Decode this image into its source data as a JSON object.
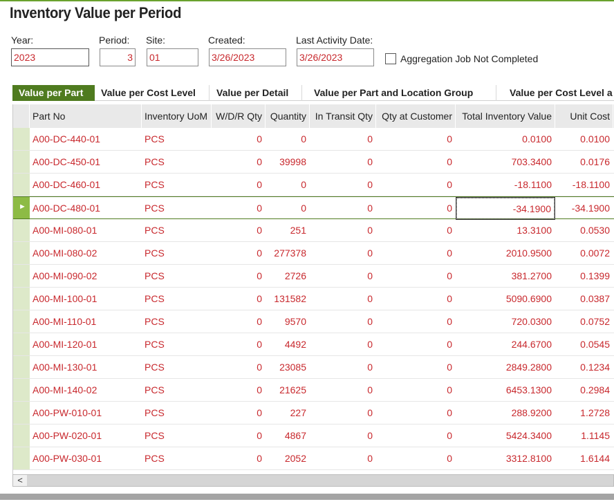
{
  "title": "Inventory Value per Period",
  "fields": {
    "year": {
      "label": "Year:",
      "value": "2023"
    },
    "period": {
      "label": "Period:",
      "value": "3"
    },
    "site": {
      "label": "Site:",
      "value": "01"
    },
    "created": {
      "label": "Created:",
      "value": "3/26/2023"
    },
    "last_activity": {
      "label": "Last Activity Date:",
      "value": "3/26/2023"
    },
    "aggregation": {
      "label": "Aggregation Job Not Completed",
      "checked": false
    }
  },
  "tabs": [
    {
      "label": "Value per Part",
      "active": true
    },
    {
      "label": "Value per Cost Level",
      "active": false
    },
    {
      "label": "Value per Detail",
      "active": false
    },
    {
      "label": "Value per Part and Location Group",
      "active": false
    },
    {
      "label": "Value per Cost Level a",
      "active": false
    }
  ],
  "columns": [
    "Part No",
    "Inventory UoM",
    "W/D/R Qty",
    "Quantity",
    "In Transit Qty",
    "Qty at Customer",
    "Total Inventory Value",
    "Unit Cost"
  ],
  "rows": [
    [
      "A00-DC-440-01",
      "PCS",
      "0",
      "0",
      "0",
      "0",
      "0.0100",
      "0.0100"
    ],
    [
      "A00-DC-450-01",
      "PCS",
      "0",
      "39998",
      "0",
      "0",
      "703.3400",
      "0.0176"
    ],
    [
      "A00-DC-460-01",
      "PCS",
      "0",
      "0",
      "0",
      "0",
      "-18.1100",
      "-18.1100"
    ],
    [
      "A00-DC-480-01",
      "PCS",
      "0",
      "0",
      "0",
      "0",
      "-34.1900",
      "-34.1900"
    ],
    [
      "A00-MI-080-01",
      "PCS",
      "0",
      "251",
      "0",
      "0",
      "13.3100",
      "0.0530"
    ],
    [
      "A00-MI-080-02",
      "PCS",
      "0",
      "277378",
      "0",
      "0",
      "2010.9500",
      "0.0072"
    ],
    [
      "A00-MI-090-02",
      "PCS",
      "0",
      "2726",
      "0",
      "0",
      "381.2700",
      "0.1399"
    ],
    [
      "A00-MI-100-01",
      "PCS",
      "0",
      "131582",
      "0",
      "0",
      "5090.6900",
      "0.0387"
    ],
    [
      "A00-MI-110-01",
      "PCS",
      "0",
      "9570",
      "0",
      "0",
      "720.0300",
      "0.0752"
    ],
    [
      "A00-MI-120-01",
      "PCS",
      "0",
      "4492",
      "0",
      "0",
      "244.6700",
      "0.0545"
    ],
    [
      "A00-MI-130-01",
      "PCS",
      "0",
      "23085",
      "0",
      "0",
      "2849.2800",
      "0.1234"
    ],
    [
      "A00-MI-140-02",
      "PCS",
      "0",
      "21625",
      "0",
      "0",
      "6453.1300",
      "0.2984"
    ],
    [
      "A00-PW-010-01",
      "PCS",
      "0",
      "227",
      "0",
      "0",
      "288.9200",
      "1.2728"
    ],
    [
      "A00-PW-020-01",
      "PCS",
      "0",
      "4867",
      "0",
      "0",
      "5424.3400",
      "1.1145"
    ],
    [
      "A00-PW-030-01",
      "PCS",
      "0",
      "2052",
      "0",
      "0",
      "3312.8100",
      "1.6144"
    ]
  ],
  "selected_row": 3,
  "scroll_left_glyph": "<",
  "row_pointer_glyph": "►",
  "colors": {
    "accent": "#4f7b1f",
    "value_text": "#c8282d",
    "row_header": "#dde9c9"
  }
}
